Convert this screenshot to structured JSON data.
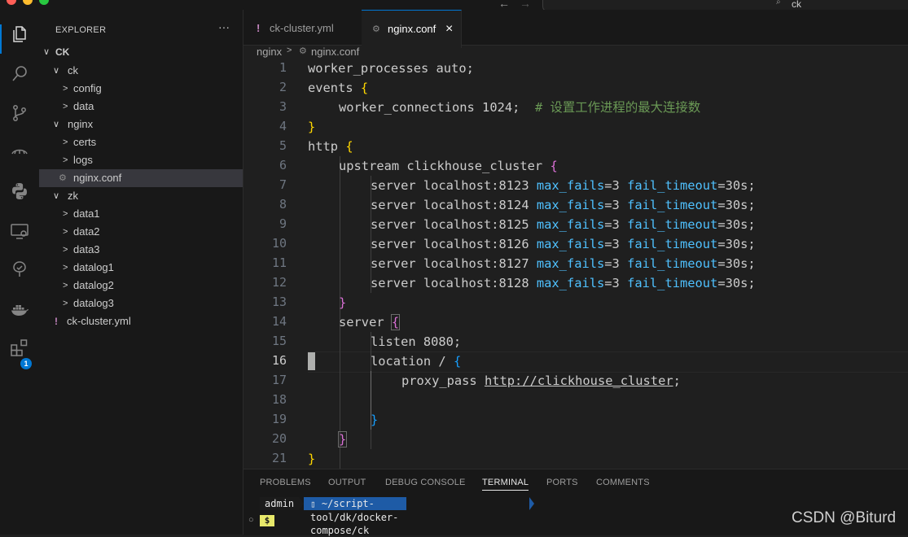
{
  "search": {
    "value": "ck"
  },
  "explorer": {
    "title": "EXPLORER",
    "more": "···",
    "root": "CK",
    "items": [
      {
        "label": "ck"
      },
      {
        "label": "config"
      },
      {
        "label": "data"
      },
      {
        "label": "nginx"
      },
      {
        "label": "certs"
      },
      {
        "label": "logs"
      },
      {
        "label": "nginx.conf"
      },
      {
        "label": "zk"
      },
      {
        "label": "data1"
      },
      {
        "label": "data2"
      },
      {
        "label": "data3"
      },
      {
        "label": "datalog1"
      },
      {
        "label": "datalog2"
      },
      {
        "label": "datalog3"
      },
      {
        "label": "ck-cluster.yml"
      }
    ]
  },
  "activity": {
    "extensions_badge": "1"
  },
  "tabs": [
    {
      "label": "ck-cluster.yml",
      "icon": "!"
    },
    {
      "label": "nginx.conf",
      "close": "×"
    }
  ],
  "breadcrumb": {
    "folder": "nginx",
    "file": "nginx.conf"
  },
  "editor": {
    "line_numbers": [
      "1",
      "2",
      "3",
      "4",
      "5",
      "6",
      "7",
      "8",
      "9",
      "10",
      "11",
      "12",
      "13",
      "14",
      "15",
      "16",
      "17",
      "18",
      "19",
      "20",
      "21"
    ],
    "current_line": "16",
    "lines": {
      "l1": "worker_processes auto;",
      "l2_kw": "events",
      "l3": "worker_connections 1024;",
      "l3_comment": "# 设置工作进程的最大连接数",
      "l5_kw": "http",
      "l6_kw": "upstream clickhouse_cluster",
      "servers": [
        {
          "addr": "server localhost:8123",
          "mf": "max_fails",
          "mfv": "=3",
          "ft": "fail_timeout",
          "ftv": "=30s;"
        },
        {
          "addr": "server localhost:8124",
          "mf": "max_fails",
          "mfv": "=3",
          "ft": "fail_timeout",
          "ftv": "=30s;"
        },
        {
          "addr": "server localhost:8125",
          "mf": "max_fails",
          "mfv": "=3",
          "ft": "fail_timeout",
          "ftv": "=30s;"
        },
        {
          "addr": "server localhost:8126",
          "mf": "max_fails",
          "mfv": "=3",
          "ft": "fail_timeout",
          "ftv": "=30s;"
        },
        {
          "addr": "server localhost:8127",
          "mf": "max_fails",
          "mfv": "=3",
          "ft": "fail_timeout",
          "ftv": "=30s;"
        },
        {
          "addr": "server localhost:8128",
          "mf": "max_fails",
          "mfv": "=3",
          "ft": "fail_timeout",
          "ftv": "=30s;"
        }
      ],
      "l14_kw": "server",
      "l15": "listen 8080;",
      "l16_kw": "location /",
      "l17_kw": "proxy_pass",
      "l17_url": "http://clickhouse_cluster",
      "l17_end": ";"
    }
  },
  "panel": {
    "tabs": [
      "PROBLEMS",
      "OUTPUT",
      "DEBUG CONSOLE",
      "TERMINAL",
      "PORTS",
      "COMMENTS"
    ],
    "active_tab": "TERMINAL",
    "prompt_user": "admin",
    "prompt_path": "~/script-tool/dk/docker-compose/ck",
    "prompt_symbol": "$"
  },
  "watermark": "CSDN @Biturd"
}
